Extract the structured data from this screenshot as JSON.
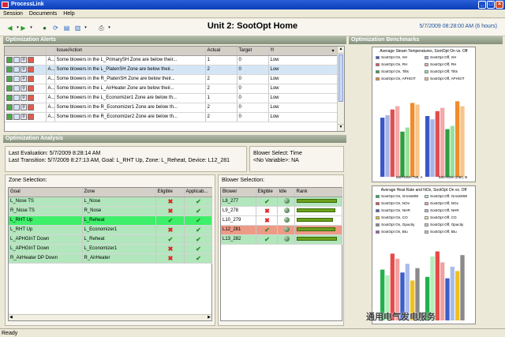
{
  "app": {
    "title": "ProcessLink"
  },
  "menu": {
    "items": [
      "Session",
      "Documents",
      "Help"
    ]
  },
  "header": {
    "title": "Unit 2: SootOpt Home",
    "datetime": "5/7/2009 08:28:00 AM (6 hours)"
  },
  "alerts": {
    "title": "Optimization Alerts",
    "columns": [
      "Issue/Action",
      "Actual",
      "Target",
      "!!!"
    ],
    "rows": [
      {
        "a": "A...",
        "issue": "Some blowers in the L_PrimarySH Zone are below their...",
        "actual": "1",
        "target": "0",
        "priority": "Low"
      },
      {
        "a": "A...",
        "issue": "Some blowers in the L_PlatenSH Zone are below their...",
        "actual": "2",
        "target": "0",
        "priority": "Low"
      },
      {
        "a": "A...",
        "issue": "Some blowers in the R_PlatenSH Zone are below their...",
        "actual": "2",
        "target": "0",
        "priority": "Low"
      },
      {
        "a": "A...",
        "issue": "Some blowers in the L_AirHeater Zone are below their...",
        "actual": "2",
        "target": "0",
        "priority": "Low"
      },
      {
        "a": "A...",
        "issue": "Some blowers in the L_Economizer1 Zone are below th...",
        "actual": "1",
        "target": "0",
        "priority": "Low"
      },
      {
        "a": "A...",
        "issue": "Some blowers in the R_Economizer1 Zone are below th...",
        "actual": "2",
        "target": "0",
        "priority": "Low"
      },
      {
        "a": "A...",
        "issue": "Some blowers in the R_Economizer2 Zone are below th...",
        "actual": "2",
        "target": "0",
        "priority": "Low"
      }
    ]
  },
  "analysis": {
    "title": "Optimization Analysis",
    "last_evaluation": "Last Evaluation: 5/7/2009 8:28:14 AM",
    "last_transition": "Last Transition: 5/7/2009 8:27:13 AM,  Goal: L_RHT Up,  Zone: L_Reheat,  Device: L12_281",
    "blower_select": "Blower Select: Time",
    "no_variable": "<No Variable>: NA",
    "zone_selection_label": "Zone Selection:",
    "zone_columns": [
      "Goal",
      "Zone",
      "Eligible",
      "Applicab..."
    ],
    "zones": [
      {
        "goal": "L_Nose TS",
        "zone": "L_Nose",
        "eligible": "x",
        "applicable": "check",
        "style": "g1"
      },
      {
        "goal": "R_Nose TS",
        "zone": "R_Nose",
        "eligible": "x",
        "applicable": "check",
        "style": "g1"
      },
      {
        "goal": "L_RHT Up",
        "zone": "L_Reheat",
        "eligible": "check",
        "applicable": "check",
        "style": "g2"
      },
      {
        "goal": "L_RHT Up",
        "zone": "L_Economizer1",
        "eligible": "x",
        "applicable": "check",
        "style": "g1"
      },
      {
        "goal": "L_APHGInT Down",
        "zone": "L_Reheat",
        "eligible": "check",
        "applicable": "check",
        "style": "g1"
      },
      {
        "goal": "L_APHGInT Down",
        "zone": "L_Economizer1",
        "eligible": "x",
        "applicable": "check",
        "style": "g1"
      },
      {
        "goal": "R_AirHeater DP Down",
        "zone": "R_AirHeater",
        "eligible": "x",
        "applicable": "check",
        "style": "g1"
      }
    ],
    "blower_selection_label": "Blower Selection:",
    "blower_columns": [
      "Blower",
      "Eligible",
      "Idle",
      "Rank"
    ],
    "blowers": [
      {
        "blower": "L8_277",
        "eligible": "check",
        "rank": 0.95,
        "style": "g1"
      },
      {
        "blower": "L9_278",
        "eligible": "x",
        "rank": 0.9,
        "style": "plain"
      },
      {
        "blower": "L10_279",
        "eligible": "x",
        "rank": 0.85,
        "style": "plain"
      },
      {
        "blower": "L12_281",
        "eligible": "check",
        "rank": 0.9,
        "style": "g3"
      },
      {
        "blower": "L13_282",
        "eligible": "check",
        "rank": 0.95,
        "style": "g1"
      }
    ]
  },
  "benchmarks": {
    "title": "Optimization Benchmarks",
    "chart1": {
      "title": "Average Steam Temperatures, SootOpt On vs. Off",
      "legend": [
        "SootOpt On, SH",
        "SootOpt Off, SH",
        "SootOpt On, RH",
        "SootOpt Off, RH",
        "SootOpt On, Tilts",
        "SootOpt Off, Tilts",
        "SootOpt On, APHGIT",
        "SootOpt Off, APHGIT"
      ],
      "xlabels": [
        "680<MW<799, A",
        "680<MW<1080, B"
      ]
    },
    "chart2": {
      "title": "Average Heat Rate and NOx, SootOpt On vs. Off",
      "legend": [
        "SootOpt On, GrossMW",
        "SootOpt Off, GrossMW",
        "SootOpt On, NOx",
        "SootOpt Off, NOx",
        "SootOpt On, NHR",
        "SootOpt Off, NHR",
        "SootOpt On, CO",
        "SootOpt Off, CO",
        "SootOpt On, Opacity",
        "SootOpt Off, Opacity",
        "SootOpt On, Btu",
        "SootOpt Off, Btu"
      ]
    },
    "colors": [
      "#3a57c9",
      "#a8b4e8",
      "#e05050",
      "#f4a8a8",
      "#2e9e3e",
      "#9ae0a0",
      "#f08c2a",
      "#f8c48a"
    ]
  },
  "watermark": "通用电气发电服务",
  "status": {
    "text": "Ready"
  }
}
